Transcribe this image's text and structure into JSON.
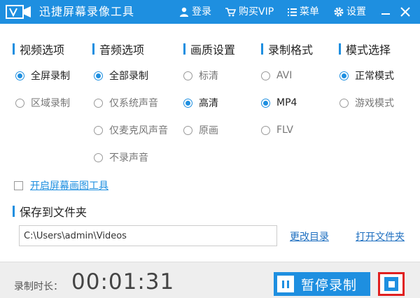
{
  "window": {
    "title": "迅捷屏幕录像工具",
    "menu": {
      "login": "登录",
      "buy": "购买VIP",
      "menu": "菜单",
      "settings": "设置"
    }
  },
  "sections": {
    "video": {
      "title": "视频选项",
      "options": [
        "全屏录制",
        "区域录制"
      ],
      "selected": "全屏录制"
    },
    "audio": {
      "title": "音频选项",
      "options": [
        "全部录制",
        "仅系统声音",
        "仅麦克风声音",
        "不录声音"
      ],
      "selected": "全部录制"
    },
    "quality": {
      "title": "画质设置",
      "options": [
        "标清",
        "高清",
        "原画"
      ],
      "selected": "高清"
    },
    "format": {
      "title": "录制格式",
      "options": [
        "AVI",
        "MP4",
        "FLV"
      ],
      "selected": "MP4"
    },
    "mode": {
      "title": "模式选择",
      "options": [
        "正常模式",
        "游戏模式"
      ],
      "selected": "正常模式"
    }
  },
  "drawing_tool": {
    "label": "开启屏幕画图工具",
    "checked": false
  },
  "save": {
    "title": "保存到文件夹",
    "path": "C:\\Users\\admin\\Videos",
    "change_dir": "更改目录",
    "open_folder": "打开文件夹"
  },
  "footer": {
    "duration_label": "录制时长：",
    "duration_value": "00:01:31",
    "pause_label": "暂停录制"
  },
  "colors": {
    "accent": "#1e8fe0",
    "stop_border": "#e02020"
  }
}
